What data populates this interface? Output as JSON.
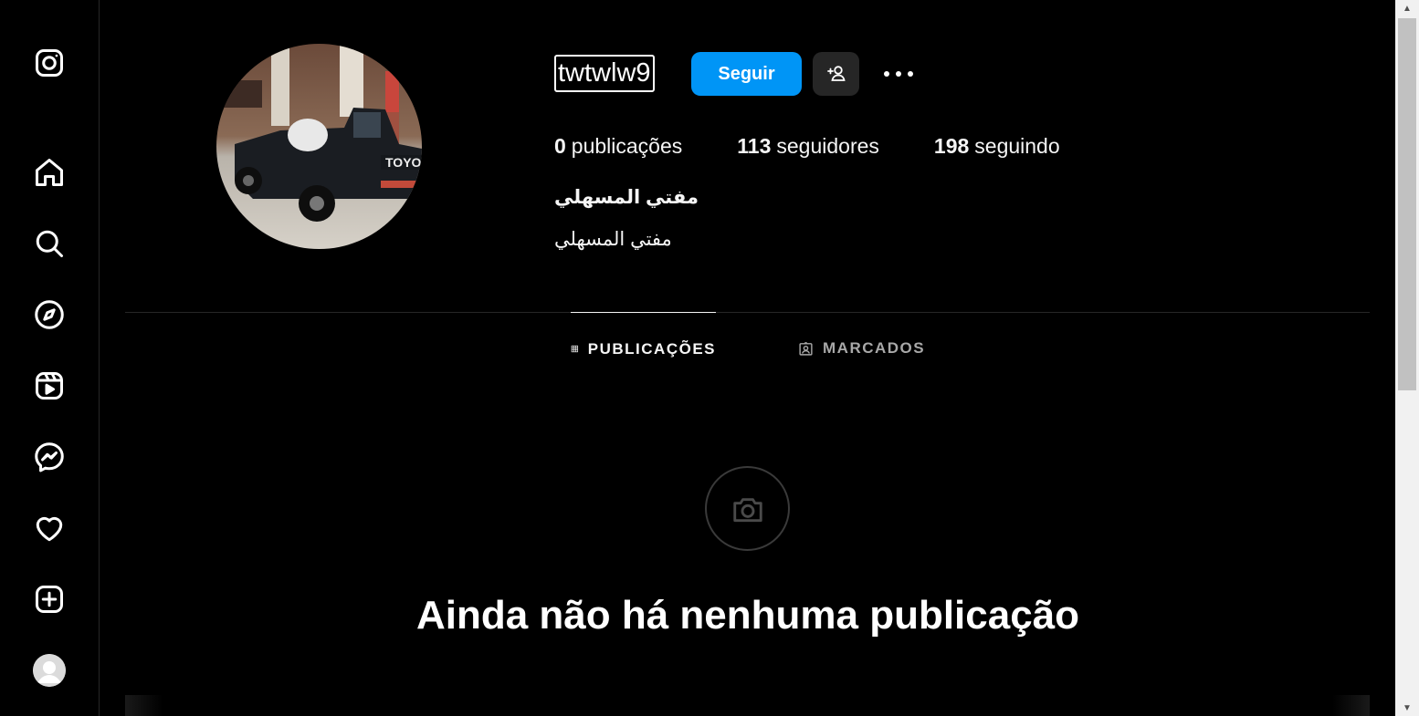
{
  "sidebar": {
    "items": [
      {
        "name": "instagram-logo-icon"
      },
      {
        "name": "home-icon"
      },
      {
        "name": "search-icon"
      },
      {
        "name": "explore-icon"
      },
      {
        "name": "reels-icon"
      },
      {
        "name": "messenger-icon"
      },
      {
        "name": "heart-icon"
      },
      {
        "name": "create-icon"
      },
      {
        "name": "profile-avatar-icon"
      }
    ]
  },
  "profile": {
    "username": "twtwlw9",
    "follow_label": "Seguir",
    "posts_count": "0",
    "posts_label": "publicações",
    "followers_count": "113",
    "followers_label": "seguidores",
    "following_count": "198",
    "following_label": "seguindo",
    "full_name": "مفتي المسهلي",
    "bio": "مفتي المسهلي"
  },
  "tabs": {
    "posts": "PUBLICAÇÕES",
    "tagged": "MARCADOS"
  },
  "empty_state": {
    "title": "Ainda não há nenhuma publicação"
  },
  "colors": {
    "background": "#000000",
    "accent": "#0095f6",
    "secondary_button": "#262626",
    "divider": "#262626"
  }
}
